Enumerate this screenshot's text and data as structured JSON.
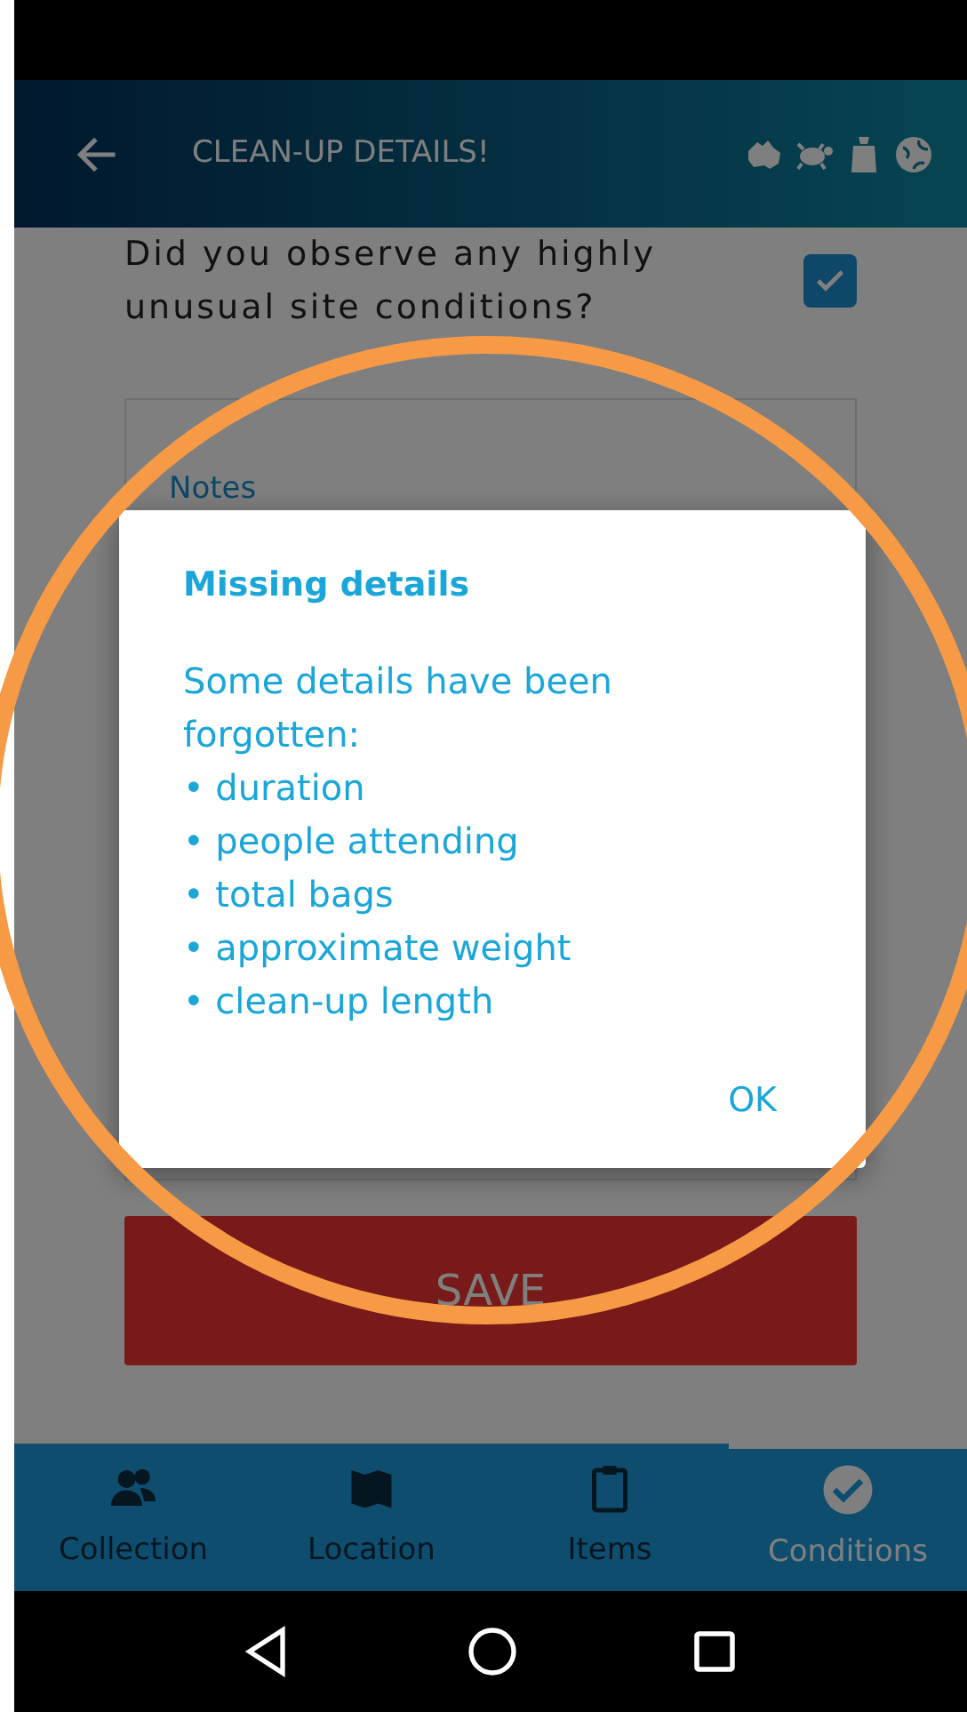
{
  "app_bar": {
    "title": "CLEAN-UP DETAILS!"
  },
  "question": {
    "text": "Did you observe any highly unusual site conditions?",
    "checked": true
  },
  "notes": {
    "label": "Notes"
  },
  "save_button": "SAVE",
  "bottom_nav": [
    {
      "label": "Collection",
      "selected": false
    },
    {
      "label": "Location",
      "selected": false
    },
    {
      "label": "Items",
      "selected": false
    },
    {
      "label": "Conditions",
      "selected": true
    }
  ],
  "dialog": {
    "title": "Missing details",
    "message": "Some details have been forgotten:",
    "items": [
      "• duration",
      "• people attending",
      "• total bags",
      "• approximate weight",
      "• clean-up length"
    ],
    "button": "OK"
  }
}
